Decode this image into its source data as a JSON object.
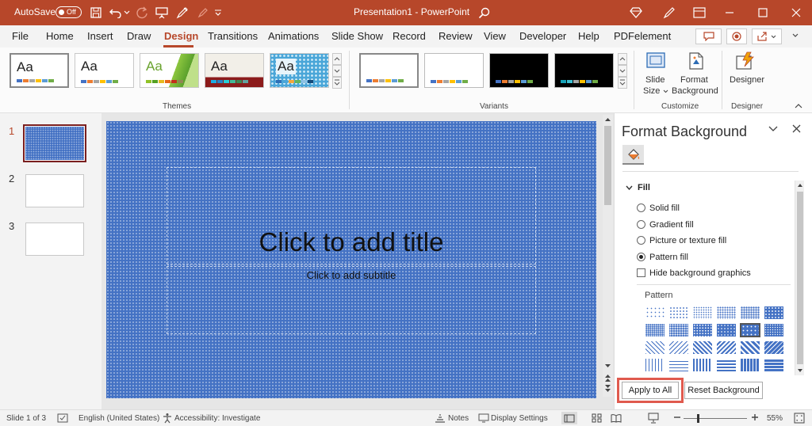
{
  "titlebar": {
    "autosave_label": "AutoSave",
    "autosave_state": "Off",
    "doc_title": "Presentation1  -  PowerPoint",
    "bg_color": "#b7472a"
  },
  "menu": {
    "tabs": [
      "File",
      "Home",
      "Insert",
      "Draw",
      "Design",
      "Transitions",
      "Animations",
      "Slide Show",
      "Record",
      "Review",
      "View",
      "Developer",
      "Help",
      "PDFelement"
    ],
    "active_tab": "Design"
  },
  "ribbon": {
    "themes_label": "Themes",
    "variants_label": "Variants",
    "customize_label": "Customize",
    "designer_group_label": "Designer",
    "theme_aa": "Aa",
    "slide_size_line1": "Slide",
    "slide_size_line2": "Size",
    "format_bg_line1": "Format",
    "format_bg_line2": "Background",
    "designer_btn": "Designer"
  },
  "thumbnails": {
    "numbers": [
      "1",
      "2",
      "3"
    ],
    "selected": "1"
  },
  "slide": {
    "title_placeholder": "Click to add title",
    "subtitle_placeholder": "Click to add subtitle",
    "bg_color": "#4472c4"
  },
  "pane": {
    "title": "Format Background",
    "section": "Fill",
    "options": [
      "Solid fill",
      "Gradient fill",
      "Picture or texture fill",
      "Pattern fill"
    ],
    "selected_option": "Pattern fill",
    "hide_graphics": "Hide background graphics",
    "pattern_label": "Pattern",
    "apply_all": "Apply to All",
    "reset": "Reset Background",
    "highlight_color": "#e05a4e"
  },
  "status": {
    "slide_info": "Slide 1 of 3",
    "language": "English (United States)",
    "accessibility": "Accessibility: Investigate",
    "notes": "Notes",
    "display_settings": "Display Settings",
    "zoom": "55%"
  }
}
